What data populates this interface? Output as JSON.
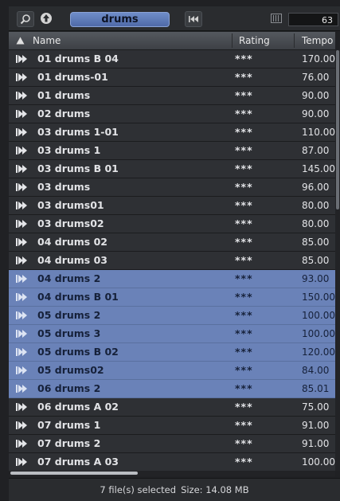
{
  "toolbar": {
    "search_value": "drums",
    "count": "63",
    "icons": [
      "search-icon",
      "up-arrow-icon",
      "rewind-icon",
      "columns-icon"
    ]
  },
  "header": {
    "name": "Name",
    "rating": "Rating",
    "tempo": "Tempo",
    "sort_icon": "sort-ascending-icon"
  },
  "rows": [
    {
      "name": "01 drums B 04",
      "rating": "***",
      "tempo": "170.00",
      "selected": false
    },
    {
      "name": "01 drums-01",
      "rating": "***",
      "tempo": "76.00",
      "selected": false
    },
    {
      "name": "01 drums",
      "rating": "***",
      "tempo": "90.00",
      "selected": false
    },
    {
      "name": "02 drums",
      "rating": "***",
      "tempo": "90.00",
      "selected": false
    },
    {
      "name": "03 drums 1-01",
      "rating": "***",
      "tempo": "110.00",
      "selected": false
    },
    {
      "name": "03 drums 1",
      "rating": "***",
      "tempo": "87.00",
      "selected": false
    },
    {
      "name": "03 drums B 01",
      "rating": "***",
      "tempo": "145.00",
      "selected": false
    },
    {
      "name": "03 drums",
      "rating": "***",
      "tempo": "96.00",
      "selected": false
    },
    {
      "name": "03 drums01",
      "rating": "***",
      "tempo": "80.00",
      "selected": false
    },
    {
      "name": "03 drums02",
      "rating": "***",
      "tempo": "80.00",
      "selected": false
    },
    {
      "name": "04 drums 02",
      "rating": "***",
      "tempo": "85.00",
      "selected": false
    },
    {
      "name": "04 drums 03",
      "rating": "***",
      "tempo": "85.00",
      "selected": false
    },
    {
      "name": "04 drums 2",
      "rating": "***",
      "tempo": "93.00",
      "selected": true
    },
    {
      "name": "04 drums B 01",
      "rating": "***",
      "tempo": "150.00",
      "selected": true
    },
    {
      "name": "05 drums 2",
      "rating": "***",
      "tempo": "100.00",
      "selected": true
    },
    {
      "name": "05 drums 3",
      "rating": "***",
      "tempo": "100.00",
      "selected": true
    },
    {
      "name": "05 drums B 02",
      "rating": "***",
      "tempo": "120.00",
      "selected": true
    },
    {
      "name": "05 drums02",
      "rating": "***",
      "tempo": "84.00",
      "selected": true
    },
    {
      "name": "06 drums 2",
      "rating": "***",
      "tempo": "85.01",
      "selected": true
    },
    {
      "name": "06 drums A 02",
      "rating": "***",
      "tempo": "75.00",
      "selected": false
    },
    {
      "name": "07 drums 1",
      "rating": "***",
      "tempo": "91.00",
      "selected": false
    },
    {
      "name": "07 drums 2",
      "rating": "***",
      "tempo": "91.00",
      "selected": false
    },
    {
      "name": "07 drums A 03",
      "rating": "***",
      "tempo": "100.00",
      "selected": false
    }
  ],
  "status": {
    "selected_text": "7 file(s) selected",
    "size_text": "Size: 14.08 MB"
  },
  "colors": {
    "selection": "#6a82b8",
    "search_field": "#5f7bbd",
    "row_background": "#2e3034"
  }
}
